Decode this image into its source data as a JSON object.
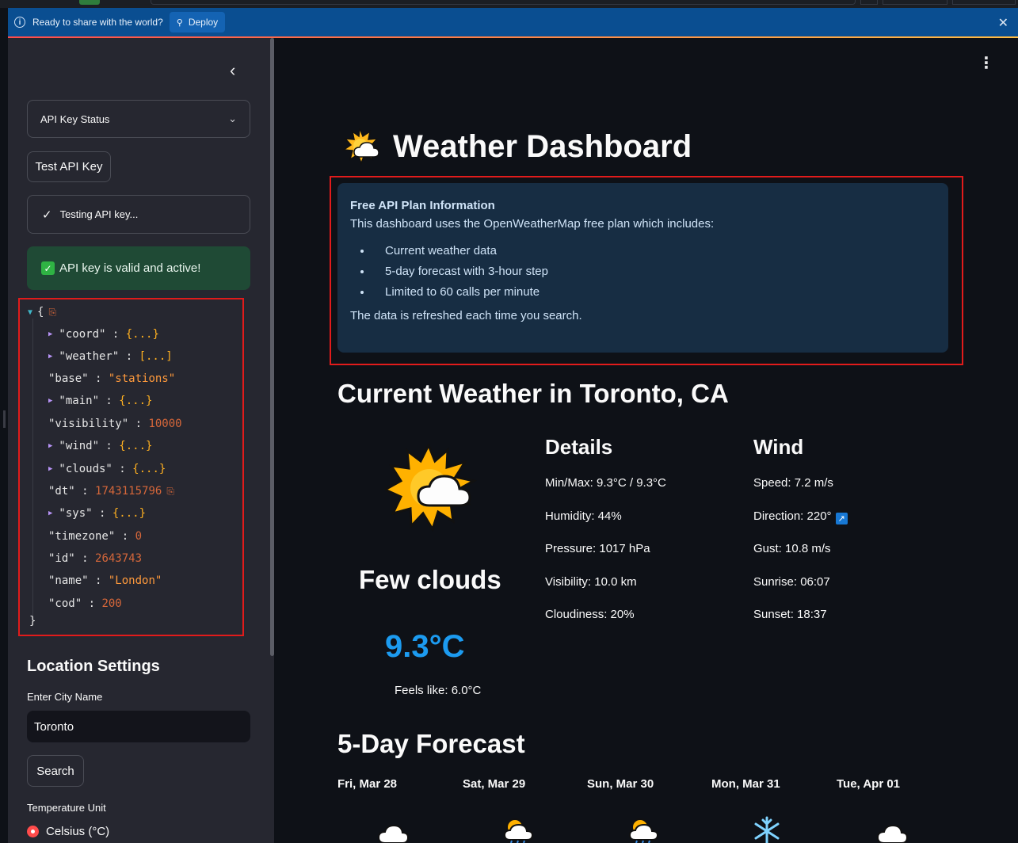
{
  "deploy_bar": {
    "message": "Ready to share with the world?",
    "deploy_label": "Deploy"
  },
  "sidebar": {
    "api_expander": "API Key Status",
    "test_button": "Test API Key",
    "status_text": "Testing API key...",
    "success_text": "API key is valid and active!",
    "json": {
      "open_brace": "{",
      "close_brace": "}",
      "entries": [
        {
          "key": "\"coord\"",
          "collapsed": "{...}"
        },
        {
          "key": "\"weather\"",
          "collapsed": "[...]"
        },
        {
          "key": "\"base\"",
          "value": "\"stations\""
        },
        {
          "key": "\"main\"",
          "collapsed": "{...}"
        },
        {
          "key": "\"visibility\"",
          "value": "10000"
        },
        {
          "key": "\"wind\"",
          "collapsed": "{...}"
        },
        {
          "key": "\"clouds\"",
          "collapsed": "{...}"
        },
        {
          "key": "\"dt\"",
          "value": "1743115796"
        },
        {
          "key": "\"sys\"",
          "collapsed": "{...}"
        },
        {
          "key": "\"timezone\"",
          "value": "0"
        },
        {
          "key": "\"id\"",
          "value": "2643743"
        },
        {
          "key": "\"name\"",
          "value": "\"London\""
        },
        {
          "key": "\"cod\"",
          "value": "200"
        }
      ]
    },
    "location_title": "Location Settings",
    "city_label": "Enter City Name",
    "city_value": "Toronto",
    "search_button": "Search",
    "unit_label": "Temperature Unit",
    "unit_selected": "Celsius (°C)"
  },
  "main": {
    "title": "Weather Dashboard",
    "info": {
      "title": "Free API Plan Information",
      "intro": "This dashboard uses the OpenWeatherMap free plan which includes:",
      "items": [
        "Current weather data",
        "5-day forecast with 3-hour step",
        "Limited to 60 calls per minute"
      ],
      "footer": "The data is refreshed each time you search."
    },
    "current_title": "Current Weather in Toronto, CA",
    "description": "Few clouds",
    "temperature": "9.3°C",
    "feels_like": "Feels like: 6.0°C",
    "details": {
      "title": "Details",
      "items": [
        "Min/Max: 9.3°C / 9.3°C",
        "Humidity: 44%",
        "Pressure: 1017 hPa",
        "Visibility: 10.0 km",
        "Cloudiness: 20%"
      ]
    },
    "wind": {
      "title": "Wind",
      "speed": "Speed: 7.2 m/s",
      "direction": "Direction: 220°",
      "direction_arrow": "↗",
      "gust": "Gust: 10.8 m/s",
      "sunrise": "Sunrise: 06:07",
      "sunset": "Sunset: 18:37"
    },
    "forecast": {
      "title": "5-Day Forecast",
      "days": [
        {
          "date": "Fri, Mar 28",
          "icon": "cloud-icon"
        },
        {
          "date": "Sat, Mar 29",
          "icon": "sun-rain-cloud-icon"
        },
        {
          "date": "Sun, Mar 30",
          "icon": "sun-rain-cloud-icon"
        },
        {
          "date": "Mon, Mar 31",
          "icon": "snowflake-icon"
        },
        {
          "date": "Tue, Apr 01",
          "icon": "cloud-icon"
        }
      ]
    }
  }
}
